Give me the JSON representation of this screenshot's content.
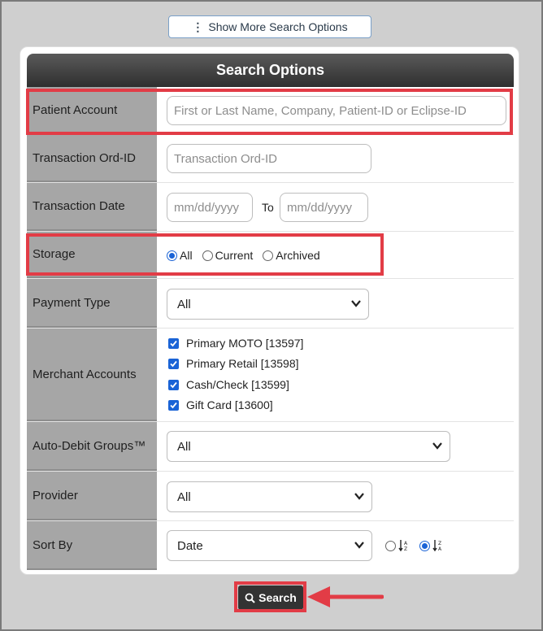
{
  "top_button": {
    "label": "Show More Search Options",
    "icon": "vertical-dots-icon"
  },
  "panel": {
    "title": "Search Options"
  },
  "patient_account": {
    "label": "Patient Account",
    "placeholder": "First or Last Name, Company, Patient-ID or Eclipse-ID"
  },
  "transaction_ord_id": {
    "label": "Transaction Ord-ID",
    "placeholder": "Transaction Ord-ID"
  },
  "transaction_date": {
    "label": "Transaction Date",
    "from_placeholder": "mm/dd/yyyy",
    "to_label": "To",
    "to_placeholder": "mm/dd/yyyy"
  },
  "storage": {
    "label": "Storage",
    "options": [
      {
        "label": "All",
        "selected": true
      },
      {
        "label": "Current",
        "selected": false
      },
      {
        "label": "Archived",
        "selected": false
      }
    ]
  },
  "payment_type": {
    "label": "Payment Type",
    "value": "All"
  },
  "merchant_accounts": {
    "label": "Merchant Accounts",
    "items": [
      {
        "label": "Primary MOTO [13597]",
        "checked": true
      },
      {
        "label": "Primary Retail [13598]",
        "checked": true
      },
      {
        "label": "Cash/Check [13599]",
        "checked": true
      },
      {
        "label": "Gift Card [13600]",
        "checked": true
      }
    ]
  },
  "auto_debit_groups": {
    "label": "Auto-Debit Groups™",
    "value": "All"
  },
  "provider": {
    "label": "Provider",
    "value": "All"
  },
  "sort_by": {
    "label": "Sort By",
    "value": "Date",
    "order": "descending"
  },
  "search_button": {
    "label": "Search",
    "icon": "search-icon"
  },
  "colors": {
    "highlight": "#e23c46",
    "accent": "#1a63d6",
    "header": "#3a3a3a",
    "label_bg": "#a6a6a6"
  }
}
